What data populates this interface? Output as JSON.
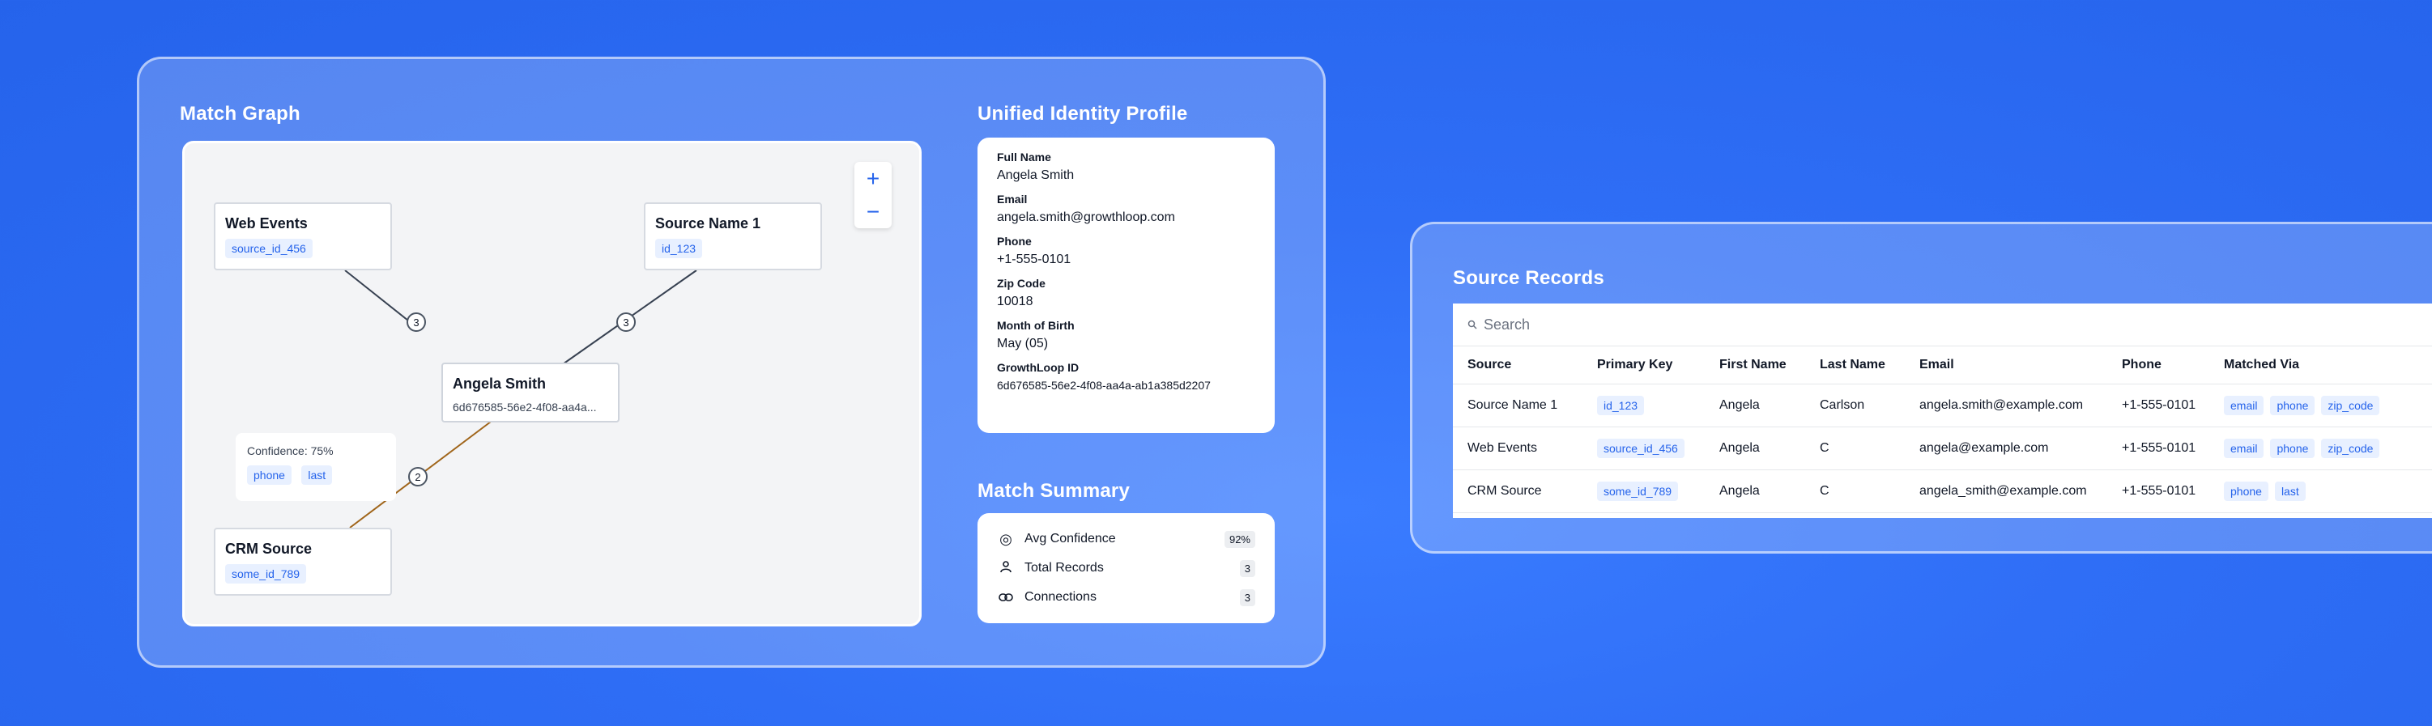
{
  "match_graph": {
    "title": "Match Graph",
    "nodes": [
      {
        "title": "Web Events",
        "tag": "source_id_456"
      },
      {
        "title": "Source Name 1",
        "tag": "id_123"
      },
      {
        "title": "Angela Smith",
        "sub": "6d676585-56e2-4f08-aa4a..."
      },
      {
        "title": "CRM Source",
        "tag": "some_id_789"
      }
    ],
    "edges": [
      "3",
      "3",
      "2"
    ],
    "confidence": {
      "label": "Confidence: 75%",
      "tags": [
        "phone",
        "last"
      ]
    },
    "zoom_in": "+",
    "zoom_out": "−",
    "colors": {
      "edge_dark": "#374151",
      "edge_highlight": "#a0651a",
      "accent": "#2563eb"
    }
  },
  "profile": {
    "title": "Unified Identity Profile",
    "fields": [
      {
        "label": "Full Name",
        "value": "Angela Smith"
      },
      {
        "label": "Email",
        "value": "angela.smith@growthloop.com"
      },
      {
        "label": "Phone",
        "value": "+1-555-0101"
      },
      {
        "label": "Zip Code",
        "value": "10018"
      },
      {
        "label": "Month of Birth",
        "value": "May (05)"
      },
      {
        "label": "GrowthLoop ID",
        "value": "6d676585-56e2-4f08-aa4a-ab1a385d2207"
      }
    ]
  },
  "summary": {
    "title": "Match Summary",
    "rows": [
      {
        "icon": "target-icon",
        "label": "Avg Confidence",
        "value": "92%"
      },
      {
        "icon": "user-icon",
        "label": "Total Records",
        "value": "3"
      },
      {
        "icon": "link-icon",
        "label": "Connections",
        "value": "3"
      }
    ]
  },
  "records": {
    "title": "Source Records",
    "search_placeholder": "Search",
    "headers": [
      "Source",
      "Primary Key",
      "First Name",
      "Last Name",
      "Email",
      "Phone",
      "Matched Via"
    ],
    "rows": [
      {
        "source": "Source Name 1",
        "key": "id_123",
        "first": "Angela",
        "last": "Carlson",
        "email": "angela.smith@example.com",
        "phone": "+1-555-0101",
        "via": [
          "email",
          "phone",
          "zip_code"
        ]
      },
      {
        "source": "Web Events",
        "key": "source_id_456",
        "first": "Angela",
        "last": "C",
        "email": "angela@example.com",
        "phone": "+1-555-0101",
        "via": [
          "email",
          "phone",
          "zip_code"
        ]
      },
      {
        "source": "CRM Source",
        "key": "some_id_789",
        "first": "Angela",
        "last": "C",
        "email": "angela_smith@example.com",
        "phone": "+1-555-0101",
        "via": [
          "phone",
          "last"
        ]
      }
    ]
  }
}
